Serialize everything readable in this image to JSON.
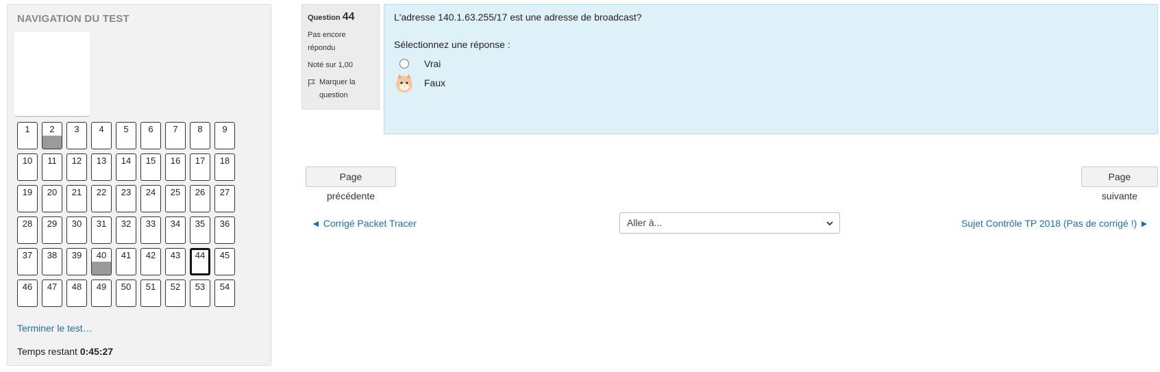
{
  "nav": {
    "title": "NAVIGATION DU TEST",
    "questions": [
      {
        "n": "1",
        "state": "notyetanswered"
      },
      {
        "n": "2",
        "state": "answered"
      },
      {
        "n": "3",
        "state": "notyetanswered"
      },
      {
        "n": "4",
        "state": "notyetanswered"
      },
      {
        "n": "5",
        "state": "notyetanswered"
      },
      {
        "n": "6",
        "state": "notyetanswered"
      },
      {
        "n": "7",
        "state": "notyetanswered"
      },
      {
        "n": "8",
        "state": "notyetanswered"
      },
      {
        "n": "9",
        "state": "notyetanswered"
      },
      {
        "n": "10",
        "state": "notyetanswered"
      },
      {
        "n": "11",
        "state": "notyetanswered"
      },
      {
        "n": "12",
        "state": "notyetanswered"
      },
      {
        "n": "13",
        "state": "notyetanswered"
      },
      {
        "n": "14",
        "state": "notyetanswered"
      },
      {
        "n": "15",
        "state": "notyetanswered"
      },
      {
        "n": "16",
        "state": "notyetanswered"
      },
      {
        "n": "17",
        "state": "notyetanswered"
      },
      {
        "n": "18",
        "state": "notyetanswered"
      },
      {
        "n": "19",
        "state": "notyetanswered"
      },
      {
        "n": "20",
        "state": "notyetanswered"
      },
      {
        "n": "21",
        "state": "notyetanswered"
      },
      {
        "n": "22",
        "state": "notyetanswered"
      },
      {
        "n": "23",
        "state": "notyetanswered"
      },
      {
        "n": "24",
        "state": "notyetanswered"
      },
      {
        "n": "25",
        "state": "notyetanswered"
      },
      {
        "n": "26",
        "state": "notyetanswered"
      },
      {
        "n": "27",
        "state": "notyetanswered"
      },
      {
        "n": "28",
        "state": "notyetanswered"
      },
      {
        "n": "29",
        "state": "notyetanswered"
      },
      {
        "n": "30",
        "state": "notyetanswered"
      },
      {
        "n": "31",
        "state": "notyetanswered"
      },
      {
        "n": "32",
        "state": "notyetanswered"
      },
      {
        "n": "33",
        "state": "notyetanswered"
      },
      {
        "n": "34",
        "state": "notyetanswered"
      },
      {
        "n": "35",
        "state": "notyetanswered"
      },
      {
        "n": "36",
        "state": "notyetanswered"
      },
      {
        "n": "37",
        "state": "notyetanswered"
      },
      {
        "n": "38",
        "state": "notyetanswered"
      },
      {
        "n": "39",
        "state": "notyetanswered"
      },
      {
        "n": "40",
        "state": "answered"
      },
      {
        "n": "41",
        "state": "notyetanswered"
      },
      {
        "n": "42",
        "state": "notyetanswered"
      },
      {
        "n": "43",
        "state": "notyetanswered"
      },
      {
        "n": "44",
        "state": "current"
      },
      {
        "n": "45",
        "state": "notyetanswered"
      },
      {
        "n": "46",
        "state": "notyetanswered"
      },
      {
        "n": "47",
        "state": "notyetanswered"
      },
      {
        "n": "48",
        "state": "notyetanswered"
      },
      {
        "n": "49",
        "state": "notyetanswered"
      },
      {
        "n": "50",
        "state": "notyetanswered"
      },
      {
        "n": "51",
        "state": "notyetanswered"
      },
      {
        "n": "52",
        "state": "notyetanswered"
      },
      {
        "n": "53",
        "state": "notyetanswered"
      },
      {
        "n": "54",
        "state": "notyetanswered"
      }
    ],
    "finish_link": "Terminer le test…",
    "time_label": "Temps restant",
    "time_value": "0:45:27"
  },
  "question": {
    "label": "Question",
    "number": "44",
    "status": "Pas encore répondu",
    "grade": "Noté sur 1,00",
    "flag_label": "Marquer la question",
    "flag_icon": "flag-icon",
    "text": "L'adresse 140.1.63.255/17 est une adresse de broadcast?",
    "prompt": "Sélectionnez une réponse :",
    "answers": [
      "Vrai",
      "Faux"
    ]
  },
  "buttons": {
    "prev": "Page précédente",
    "next": "Page suivante"
  },
  "activity_nav": {
    "prev": "◄ Corrigé Packet Tracer",
    "jump_placeholder": "Aller à...",
    "next": "Sujet Contrôle TP 2018 (Pas de corrigé !) ►"
  },
  "colors": {
    "link": "#1f6fa6",
    "content_bg": "#def0f8",
    "answered_fill": "#9a9a9a"
  }
}
